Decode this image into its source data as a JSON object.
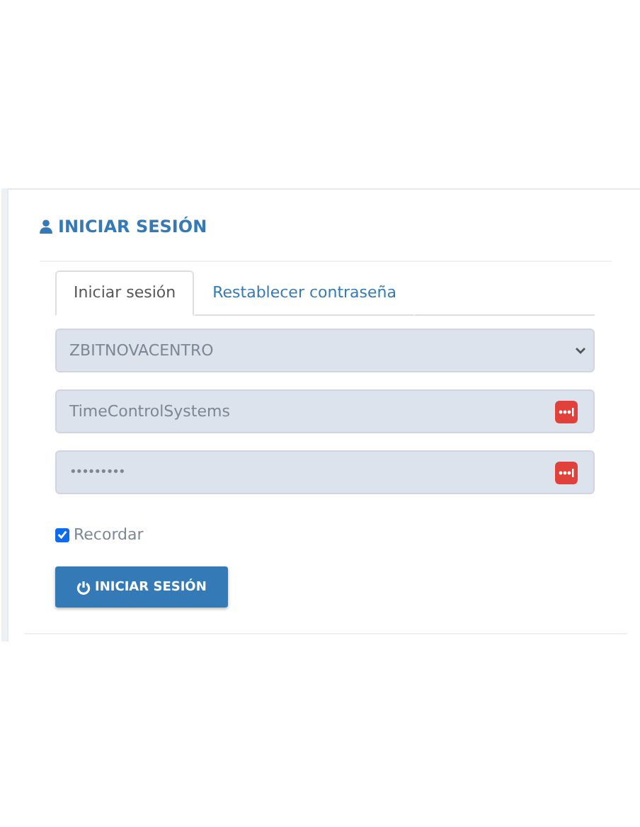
{
  "panel": {
    "title": "INICIAR SESIÓN"
  },
  "tabs": [
    {
      "label": "Iniciar sesión",
      "selected": true
    },
    {
      "label": "Restablecer contraseña",
      "selected": false
    }
  ],
  "company_select": {
    "value": "ZBITNOVACENTRO"
  },
  "username": {
    "value": "TimeControlSystems"
  },
  "password": {
    "value": "•••••••••"
  },
  "remember": {
    "label": "Recordar",
    "checked": true
  },
  "submit_button": {
    "label": "INICIAR SESIÓN"
  }
}
